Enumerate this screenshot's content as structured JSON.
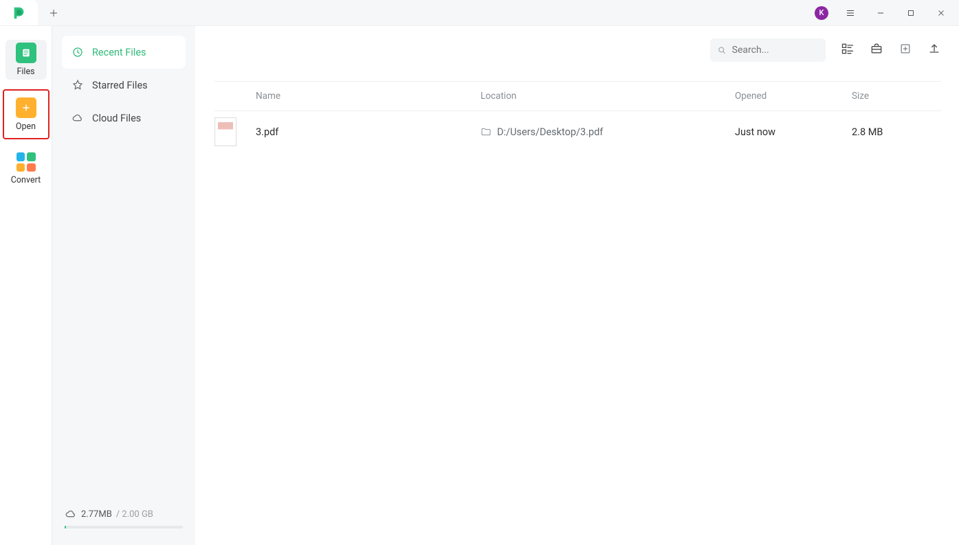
{
  "titlebar": {
    "avatar_letter": "K"
  },
  "rail": {
    "items": [
      {
        "label": "Files"
      },
      {
        "label": "Open"
      },
      {
        "label": "Convert"
      }
    ]
  },
  "sidebar": {
    "items": [
      {
        "label": "Recent Files"
      },
      {
        "label": "Starred Files"
      },
      {
        "label": "Cloud Files"
      }
    ]
  },
  "storage": {
    "used": "2.77MB",
    "total": "/ 2.00 GB"
  },
  "toolbar": {
    "search_placeholder": "Search..."
  },
  "table": {
    "headers": {
      "name": "Name",
      "location": "Location",
      "opened": "Opened",
      "size": "Size"
    },
    "rows": [
      {
        "name": "3.pdf",
        "location": "D:/Users/Desktop/3.pdf",
        "opened": "Just now",
        "size": "2.8 MB"
      }
    ]
  }
}
